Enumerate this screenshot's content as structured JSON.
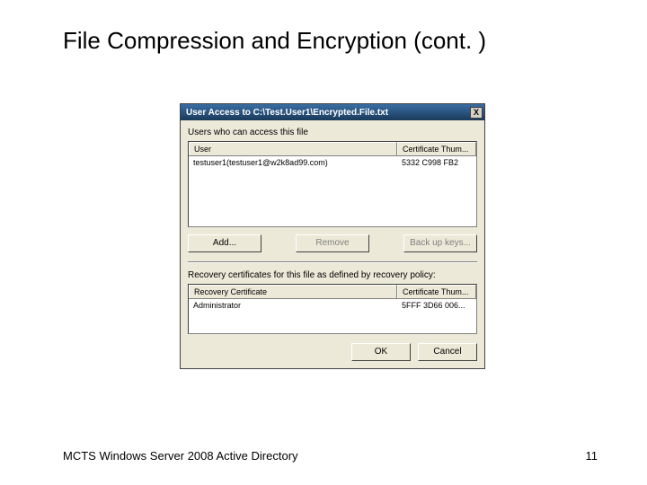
{
  "slide": {
    "title": "File Compression and Encryption (cont. )",
    "footer_left": "MCTS Windows Server 2008 Active Directory",
    "footer_right": "11"
  },
  "dialog": {
    "title": "User Access to C:\\Test.User1\\Encrypted.File.txt",
    "label_users": "Users who can access this file",
    "col_user": "User",
    "col_thumb": "Certificate Thum...",
    "row1_user": "testuser1(testuser1@w2k8ad99.com)",
    "row1_thumb": "5332 C998 FB2",
    "btn_add": "Add...",
    "btn_remove": "Remove",
    "btn_backup": "Back up keys...",
    "label_recovery": "Recovery certificates for this file as defined by recovery policy:",
    "col_recovery": "Recovery Certificate",
    "col_thumb2": "Certificate Thum...",
    "row2_user": "Administrator",
    "row2_thumb": "5FFF 3D66 006...",
    "btn_ok": "OK",
    "btn_cancel": "Cancel"
  }
}
